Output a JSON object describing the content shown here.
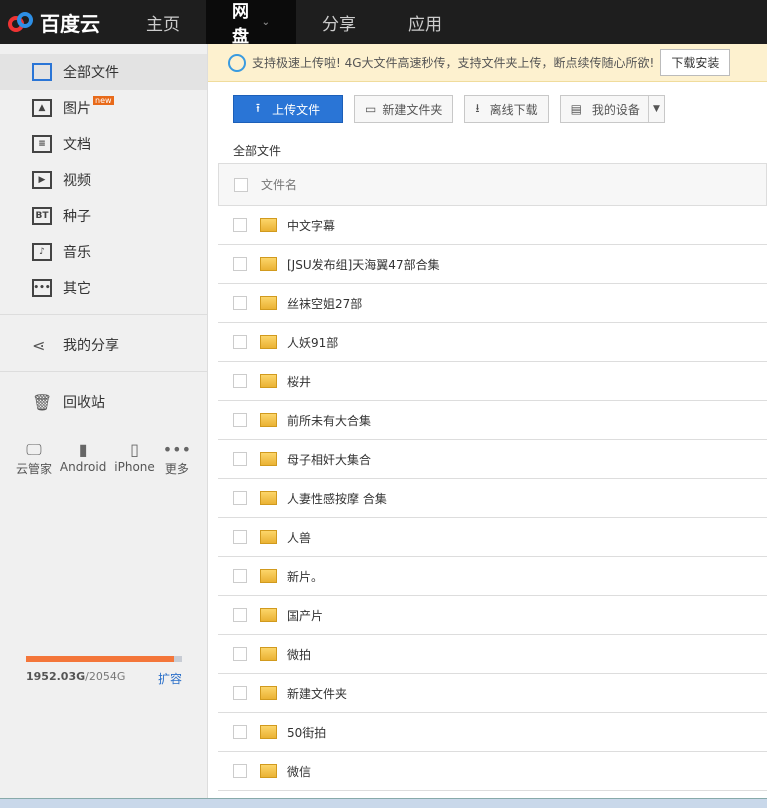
{
  "brand": "百度云",
  "nav": [
    {
      "label": "主页"
    },
    {
      "label": "网盘"
    },
    {
      "label": "分享"
    },
    {
      "label": "应用"
    }
  ],
  "sidebar": {
    "items": [
      {
        "label": "全部文件",
        "icon": "all-files-icon"
      },
      {
        "label": "图片",
        "icon": "image-icon",
        "badge": "new"
      },
      {
        "label": "文档",
        "icon": "doc-icon"
      },
      {
        "label": "视频",
        "icon": "video-icon"
      },
      {
        "label": "种子",
        "icon": "bt-icon"
      },
      {
        "label": "音乐",
        "icon": "music-icon"
      },
      {
        "label": "其它",
        "icon": "more-icon"
      }
    ],
    "share": "我的分享",
    "trash": "回收站",
    "devices": [
      {
        "label": "云管家"
      },
      {
        "label": "Android"
      },
      {
        "label": "iPhone"
      },
      {
        "label": "更多"
      }
    ],
    "quota": {
      "used": "1952.03G",
      "total": "/2054G",
      "expand": "扩容",
      "fraction": 0.95
    }
  },
  "notice": {
    "text": "支持极速上传啦! 4G大文件高速秒传，支持文件夹上传，断点续传随心所欲!",
    "button": "下载安装"
  },
  "toolbar": {
    "upload": "上传文件",
    "newfolder": "新建文件夹",
    "offline": "离线下载",
    "device": "我的设备"
  },
  "breadcrumb": "全部文件",
  "table": {
    "header": "文件名",
    "rows": [
      "中文字幕",
      "[JSU发布组]天海翼47部合集",
      "丝袜空姐27部",
      "人妖91部",
      "桜井",
      "前所未有大合集",
      "母子相奸大集合",
      "人妻性感按摩 合集",
      "人兽",
      "新片。",
      "国产片",
      "微拍",
      "新建文件夹",
      "50街拍",
      "微信"
    ]
  }
}
